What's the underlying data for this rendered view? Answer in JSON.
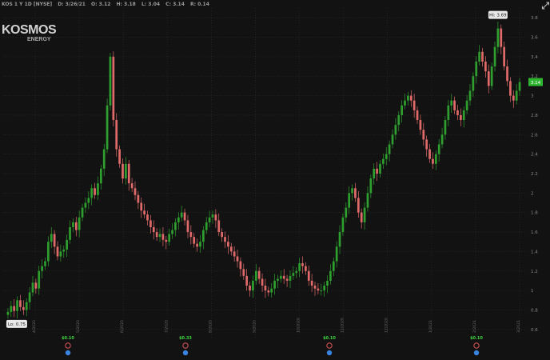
{
  "header": {
    "symbol": "KOS 1 Y 1D [NYSE]",
    "date": "D: 3/26/21",
    "open": "O: 3.12",
    "high": "H: 3.18",
    "low": "L: 3.04",
    "close": "C: 3.14",
    "range": "R: 0.14"
  },
  "logo": {
    "main": "KOSMOS",
    "sub": "ENERGY"
  },
  "zoom_icon": "zoom-icon",
  "colors": {
    "up": "#2e9e2e",
    "down": "#e06a6a",
    "grid": "#2e2e2e",
    "bg": "#121212",
    "last_tag": "#2fb52f",
    "div_green": "#3fd43f",
    "earn_red": "#e05555",
    "earn_blue": "#3b83e0"
  },
  "chart_data": {
    "type": "candlestick",
    "title": "KOS 1 Y 1D [NYSE]",
    "ylim": [
      0.5,
      3.9
    ],
    "y_ticks": [
      "3.8",
      "3.6",
      "3.4",
      "3.2",
      "3",
      "2.8",
      "2.6",
      "2.4",
      "2.2",
      "2",
      "1.8",
      "1.6",
      "1.4",
      "1.2",
      "1",
      "0.8",
      "0.6"
    ],
    "x_tick_labels": [
      "4/2020",
      "5/2020",
      "6/2020",
      "7/2020",
      "8/2020",
      "9/2020",
      "10/2020",
      "11/2020",
      "12/2020",
      "1/2021",
      "2/2021",
      "3/2021"
    ],
    "grid": true,
    "last_price": "3.14",
    "high_label": "Hi: 3.69",
    "low_label": "Lo: 0.75",
    "dividend_labels": [
      "$0.10",
      "$0.33",
      "$0.10",
      "$0.10"
    ],
    "close_series": [
      0.78,
      0.84,
      0.79,
      0.9,
      0.83,
      0.8,
      0.88,
      0.98,
      1.08,
      1.02,
      1.2,
      1.25,
      1.3,
      1.5,
      1.58,
      1.45,
      1.35,
      1.4,
      1.42,
      1.52,
      1.65,
      1.7,
      1.62,
      1.75,
      1.85,
      1.9,
      1.95,
      2.05,
      1.98,
      2.1,
      2.25,
      2.45,
      2.9,
      3.4,
      2.75,
      2.45,
      2.3,
      2.15,
      2.3,
      2.1,
      2.05,
      1.98,
      1.9,
      1.82,
      1.78,
      1.72,
      1.65,
      1.6,
      1.55,
      1.58,
      1.52,
      1.5,
      1.58,
      1.62,
      1.7,
      1.75,
      1.8,
      1.72,
      1.6,
      1.55,
      1.48,
      1.45,
      1.5,
      1.62,
      1.7,
      1.75,
      1.78,
      1.72,
      1.6,
      1.55,
      1.5,
      1.45,
      1.4,
      1.35,
      1.3,
      1.22,
      1.15,
      1.05,
      1.0,
      1.1,
      1.2,
      1.12,
      1.05,
      1.0,
      0.98,
      1.02,
      1.1,
      1.12,
      1.15,
      1.12,
      1.1,
      1.15,
      1.18,
      1.2,
      1.28,
      1.25,
      1.2,
      1.1,
      1.05,
      1.02,
      1.0,
      1.0,
      1.05,
      1.1,
      1.2,
      1.3,
      1.45,
      1.6,
      1.75,
      1.85,
      2.0,
      2.05,
      1.95,
      1.8,
      1.7,
      1.85,
      2.0,
      2.15,
      2.25,
      2.2,
      2.3,
      2.35,
      2.4,
      2.5,
      2.6,
      2.7,
      2.8,
      2.9,
      2.95,
      3.0,
      2.95,
      2.85,
      2.75,
      2.65,
      2.55,
      2.45,
      2.35,
      2.3,
      2.4,
      2.5,
      2.6,
      2.75,
      2.9,
      2.95,
      2.85,
      2.8,
      2.75,
      2.85,
      2.95,
      3.05,
      3.2,
      3.35,
      3.45,
      3.35,
      3.25,
      3.1,
      3.3,
      3.5,
      3.69,
      3.5,
      3.3,
      3.15,
      3.0,
      2.95,
      3.05,
      3.14
    ]
  }
}
